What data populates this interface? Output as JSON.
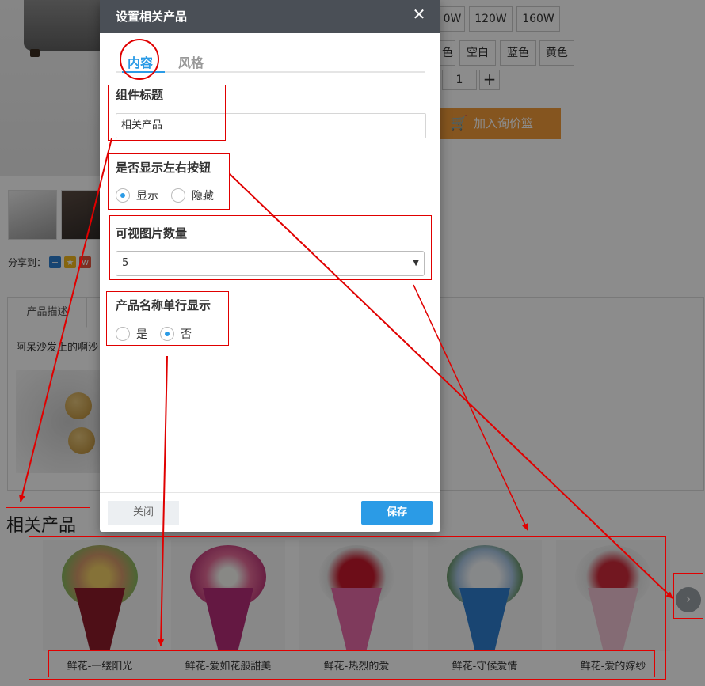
{
  "background": {
    "power_options": [
      "0W",
      "120W",
      "160W"
    ],
    "color_options": [
      "色",
      "空白",
      "蓝色",
      "黄色"
    ],
    "quantity": "1",
    "quantity_plus": "+",
    "inquiry_button": "加入询价篮",
    "share_label": "分享到：",
    "description_tab": "产品描述",
    "description_text": "阿呆沙发上的啊沙",
    "related_title": "相关产品",
    "products": [
      {
        "name": "鲜花-一缕阳光",
        "color": "#e7c24c"
      },
      {
        "name": "鲜花-爱如花般甜美",
        "color": "#e0608f"
      },
      {
        "name": "鲜花-热烈的爱",
        "color": "#c6192c"
      },
      {
        "name": "鲜花-守候爱情",
        "color": "#e7eef6"
      },
      {
        "name": "鲜花-爱的嫁纱",
        "color": "#cf2b3b"
      }
    ],
    "next_arrow": "›"
  },
  "dialog": {
    "title": "设置相关产品",
    "close_symbol": "✕",
    "tabs": [
      {
        "label": "内容",
        "active": true
      },
      {
        "label": "风格",
        "active": false
      }
    ],
    "component_title": {
      "label": "组件标题",
      "value": "相关产品"
    },
    "show_nav_buttons": {
      "label": "是否显示左右按钮",
      "options": [
        "显示",
        "隐藏"
      ],
      "selected": "显示"
    },
    "visible_count": {
      "label": "可视图片数量",
      "value": "5",
      "arrow": "▼"
    },
    "single_line_name": {
      "label": "产品名称单行显示",
      "options": [
        "是",
        "否"
      ],
      "selected": "否"
    },
    "close_button": "关闭",
    "save_button": "保存",
    "accent": "#2b9be6"
  },
  "annotation_color": "#e00000"
}
